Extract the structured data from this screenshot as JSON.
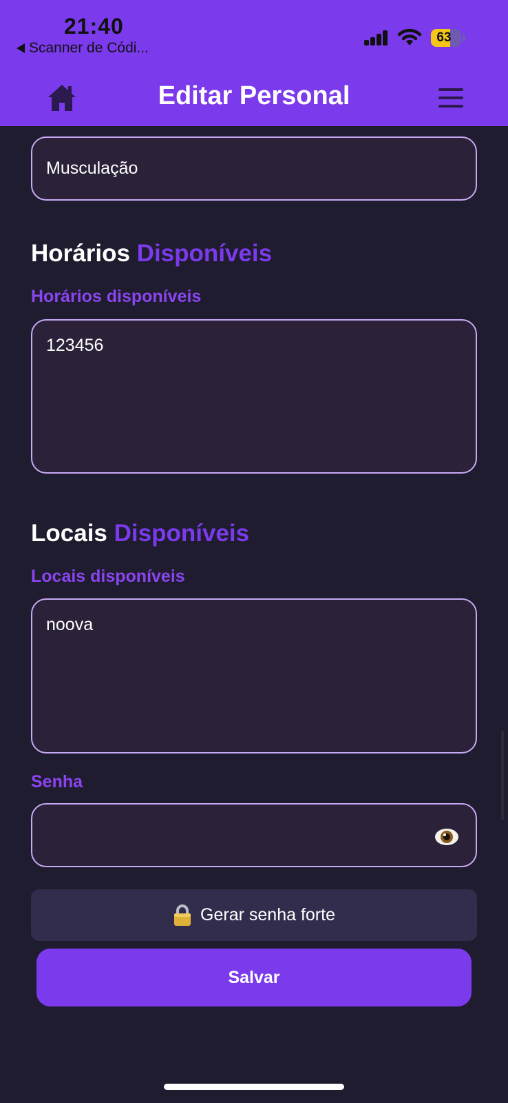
{
  "status_bar": {
    "time": "21:40",
    "back_app": "Scanner de Códi...",
    "battery": 63,
    "battery_label": "63"
  },
  "header": {
    "title": "Editar Personal",
    "home_icon": "home-icon",
    "menu_icon": "hamburger-menu-icon"
  },
  "form": {
    "modalidade_value": "Musculação",
    "horarios_section": {
      "title_a": "Horários",
      "title_b": "Disponíveis"
    },
    "horarios_label": "Horários disponíveis",
    "horarios_value": "123456",
    "locais_section": {
      "title_a": "Locais",
      "title_b": "Disponíveis"
    },
    "locais_label": "Locais disponíveis",
    "locais_value": "noova",
    "senha_label": "Senha",
    "senha_value": "",
    "eye_icon": "eye-icon"
  },
  "buttons": {
    "generate_icon": "lock-icon",
    "generate_label": "Gerar senha forte",
    "save_label": "Salvar"
  },
  "colors": {
    "accent": "#7b3aec",
    "background": "#1e1c2e",
    "field_bg": "#2b2239",
    "field_border": "#c8a9f5"
  }
}
